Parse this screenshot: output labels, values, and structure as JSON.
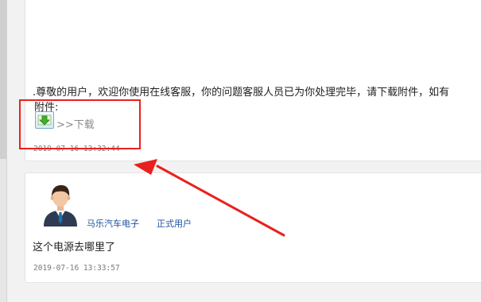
{
  "message1": {
    "text": ".尊敬的用户，欢迎你使用在线客服，你的问题客服人员已为你处理完毕，请下载附件，如有",
    "attachment_label": "附件:",
    "download_label": ">>下载",
    "timestamp": "2019-07-16 13:32:44"
  },
  "message2": {
    "user_name": "马乐汽车电子",
    "user_role": "正式用户",
    "text": "这个电源去哪里了",
    "timestamp": "2019-07-16 13:33:57"
  },
  "annotation": {
    "color": "#e8211e"
  },
  "icons": {
    "download": "download-arrow-icon",
    "avatar": "user-avatar-icon"
  }
}
